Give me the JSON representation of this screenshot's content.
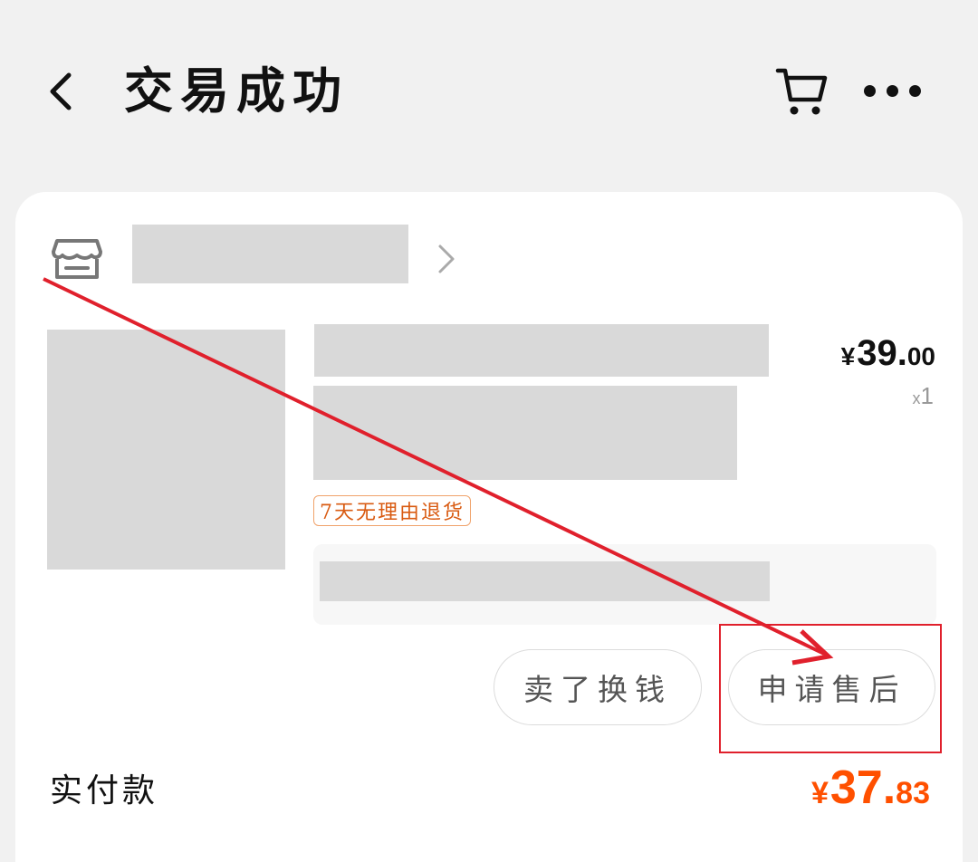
{
  "header": {
    "title": "交易成功",
    "back_icon": "chevron-left-icon",
    "cart_icon": "cart-icon",
    "more_icon": "more-dots-icon"
  },
  "store": {
    "icon": "store-icon",
    "chevron_icon": "chevron-right-icon"
  },
  "product": {
    "price_symbol": "¥",
    "price_integer": "39.",
    "price_decimal": "00",
    "quantity_prefix": "x",
    "quantity": "1",
    "return_badge": "7天无理由退货"
  },
  "actions": {
    "sell_label": "卖了换钱",
    "after_sale_label": "申请售后"
  },
  "payment": {
    "label": "实付款",
    "symbol": "¥",
    "integer": "37.",
    "decimal": "83"
  },
  "colors": {
    "accent": "#ff5000",
    "annotation": "#e0202c",
    "badge_text": "#d95b12"
  }
}
